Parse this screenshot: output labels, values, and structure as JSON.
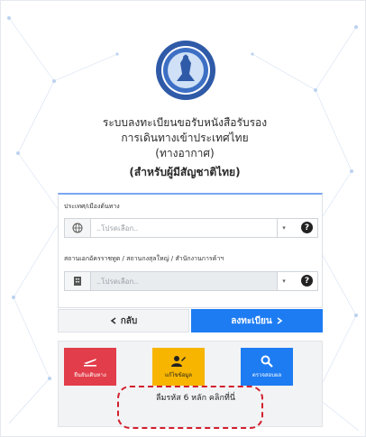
{
  "header": {
    "title_line1": "ระบบลงทะเบียนขอรับหนังสือรับรอง",
    "title_line2": "การเดินทางเข้าประเทศไทย",
    "title_line3": "(ทางอากาศ)",
    "title_line4": "(สำหรับผู้มีสัญชาติไทย)"
  },
  "form": {
    "country_label": "ประเทศ/เมืองต้นทาง",
    "country_placeholder": "..โปรดเลือก..",
    "embassy_label": "สถานเอกอัครราชทูต / สถานกงสุลใหญ่ / สำนักงานการค้าฯ",
    "embassy_placeholder": "..โปรดเลือก..",
    "help_glyph": "?",
    "caret_glyph": "▾"
  },
  "nav": {
    "back_label": "กลับ",
    "back_icon": "chevron-left-icon",
    "register_label": "ลงทะเบียน",
    "register_icon": "chevron-right-icon"
  },
  "actions": {
    "plan_label": "ยืนยันเดินทาง",
    "edit_label": "แก้ไขข้อมูล",
    "check_label": "ตรวจสอบผล",
    "forgot_label": "ลืมรหัส 6 หลัก คลิกที่นี่"
  },
  "colors": {
    "primary": "#1d7cf2",
    "danger": "#e23d4a",
    "warning": "#f7b500",
    "highlight": "#d21f2e"
  }
}
